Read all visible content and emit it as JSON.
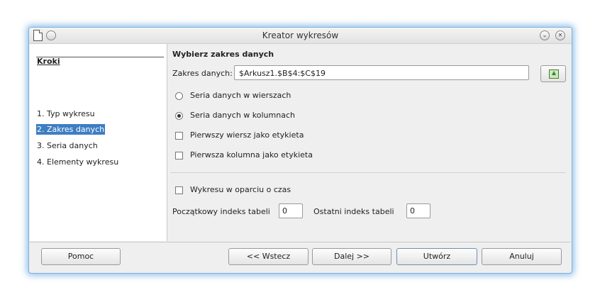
{
  "window": {
    "title": "Kreator wykresów",
    "minimize_glyph": "⌄",
    "close_glyph": "✕"
  },
  "sidebar": {
    "title": "Kroki",
    "steps": [
      {
        "label": "1. Typ wykresu",
        "active": false
      },
      {
        "label": "2. Zakres danych",
        "active": true
      },
      {
        "label": "3. Seria danych",
        "active": false
      },
      {
        "label": "4. Elementy wykresu",
        "active": false
      }
    ]
  },
  "main": {
    "heading": "Wybierz zakres danych",
    "range_label": "Zakres danych:",
    "range_value": "$Arkusz1.$B$4:$C$19",
    "options": {
      "rows": "Seria danych w wierszach",
      "columns": "Seria danych w kolumnach",
      "first_row_label": "Pierwszy wiersz jako etykieta",
      "first_col_label": "Pierwsza kolumna jako etykieta",
      "time_based": "Wykresu w oparciu o czas"
    },
    "selected_series": "columns",
    "start_index_label": "Początkowy indeks tabeli",
    "start_index_value": "0",
    "end_index_label": "Ostatni indeks tabeli",
    "end_index_value": "0"
  },
  "buttons": {
    "help": "Pomoc",
    "back": "<< Wstecz",
    "next": "Dalej >>",
    "create": "Utwórz",
    "cancel": "Anuluj"
  },
  "icons": {
    "window_menu": "document-icon",
    "window_pin": "pin-circle-icon",
    "range_picker": "select-range-icon"
  }
}
